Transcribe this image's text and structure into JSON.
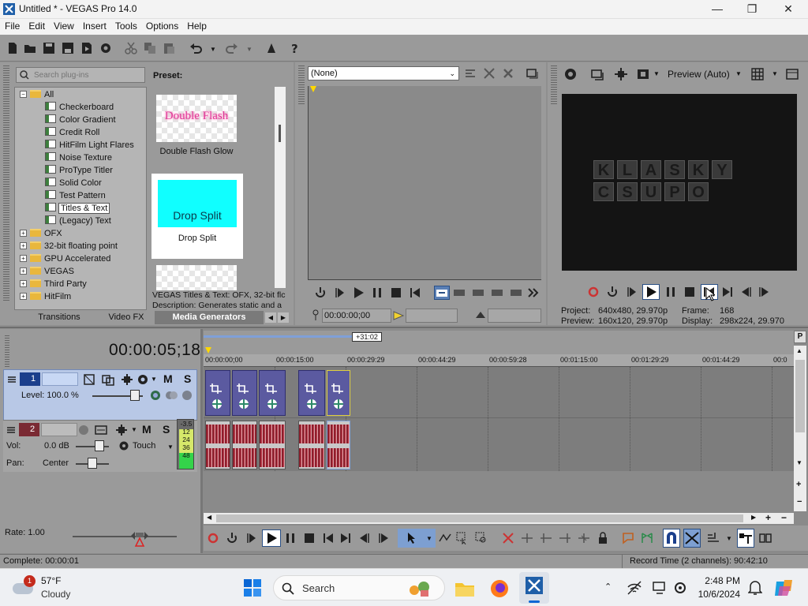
{
  "window": {
    "title": "Untitled * - VEGAS Pro 14.0",
    "minimize": "—",
    "maximize": "❐",
    "close": "✕"
  },
  "menu": [
    "File",
    "Edit",
    "View",
    "Insert",
    "Tools",
    "Options",
    "Help"
  ],
  "plugins": {
    "search_placeholder": "Search plug-ins",
    "preset_label": "Preset:",
    "tree": [
      {
        "label": "All",
        "type": "folder",
        "expanded": true
      },
      {
        "label": "Checkerboard",
        "type": "plugin"
      },
      {
        "label": "Color Gradient",
        "type": "plugin"
      },
      {
        "label": "Credit Roll",
        "type": "plugin"
      },
      {
        "label": "HitFilm Light Flares",
        "type": "plugin"
      },
      {
        "label": "Noise Texture",
        "type": "plugin"
      },
      {
        "label": "ProType Titler",
        "type": "plugin"
      },
      {
        "label": "Solid Color",
        "type": "plugin"
      },
      {
        "label": "Test Pattern",
        "type": "plugin"
      },
      {
        "label": "Titles & Text",
        "type": "plugin",
        "selected": true
      },
      {
        "label": "(Legacy) Text",
        "type": "plugin"
      },
      {
        "label": "OFX",
        "type": "folder"
      },
      {
        "label": "32-bit floating point",
        "type": "folder"
      },
      {
        "label": "GPU Accelerated",
        "type": "folder"
      },
      {
        "label": "VEGAS",
        "type": "folder"
      },
      {
        "label": "Third Party",
        "type": "folder"
      },
      {
        "label": "HitFilm",
        "type": "folder"
      }
    ],
    "presets": [
      {
        "thumb_text": "Double Flash",
        "label": "Double Flash Glow"
      },
      {
        "thumb_text": "Drop Split",
        "label": "Drop Split"
      }
    ],
    "description_line1": "VEGAS Titles & Text: OFX, 32-bit flc",
    "description_line2": "Description: Generates static and a",
    "tabs": [
      "Transitions",
      "Video FX",
      "Media Generators"
    ]
  },
  "trimmer": {
    "dropdown": "(None)",
    "timecode": "00:00:00;00"
  },
  "preview": {
    "quality": "Preview (Auto)",
    "logo_top": [
      "K",
      "L",
      "A",
      "S",
      "K",
      "Y"
    ],
    "logo_bottom": [
      "C",
      "S",
      "U",
      "P",
      "O"
    ],
    "project_label": "Project:",
    "project_value": "640x480, 29.970p",
    "preview_label": "Preview:",
    "preview_value": "160x120, 29.970p",
    "frame_label": "Frame:",
    "frame_value": "168",
    "display_label": "Display:",
    "display_value": "298x224, 29.970"
  },
  "timeline": {
    "timecode": "00:00:05;18",
    "loop_length": "+31:02",
    "ruler": [
      "00:00:00;00",
      "00:00:15:00",
      "00:00:29:29",
      "00:00:44:29",
      "00:00:59:28",
      "00:01:15:00",
      "00:01:29:29",
      "00:01:44:29",
      "00:0"
    ],
    "video_track": {
      "number": "1",
      "level": "Level: 100.0 %",
      "mute": "M",
      "solo": "S"
    },
    "audio_track": {
      "number": "2",
      "vol_label": "Vol:",
      "vol_value": "0.0 dB",
      "pan_label": "Pan:",
      "pan_value": "Center",
      "touch": "Touch",
      "mute": "M",
      "solo": "S",
      "meter": [
        "-3.5",
        "12",
        "24",
        "36",
        "48"
      ]
    },
    "rate": "Rate: 1.00",
    "end_marker": "P"
  },
  "status": {
    "left": "Complete: 00:00:01",
    "right": "Record Time (2 channels): 90:42:10"
  },
  "taskbar": {
    "weather_temp": "57°F",
    "weather_desc": "Cloudy",
    "weather_badge": "1",
    "search": "Search",
    "time": "2:48 PM",
    "date": "10/6/2024"
  }
}
